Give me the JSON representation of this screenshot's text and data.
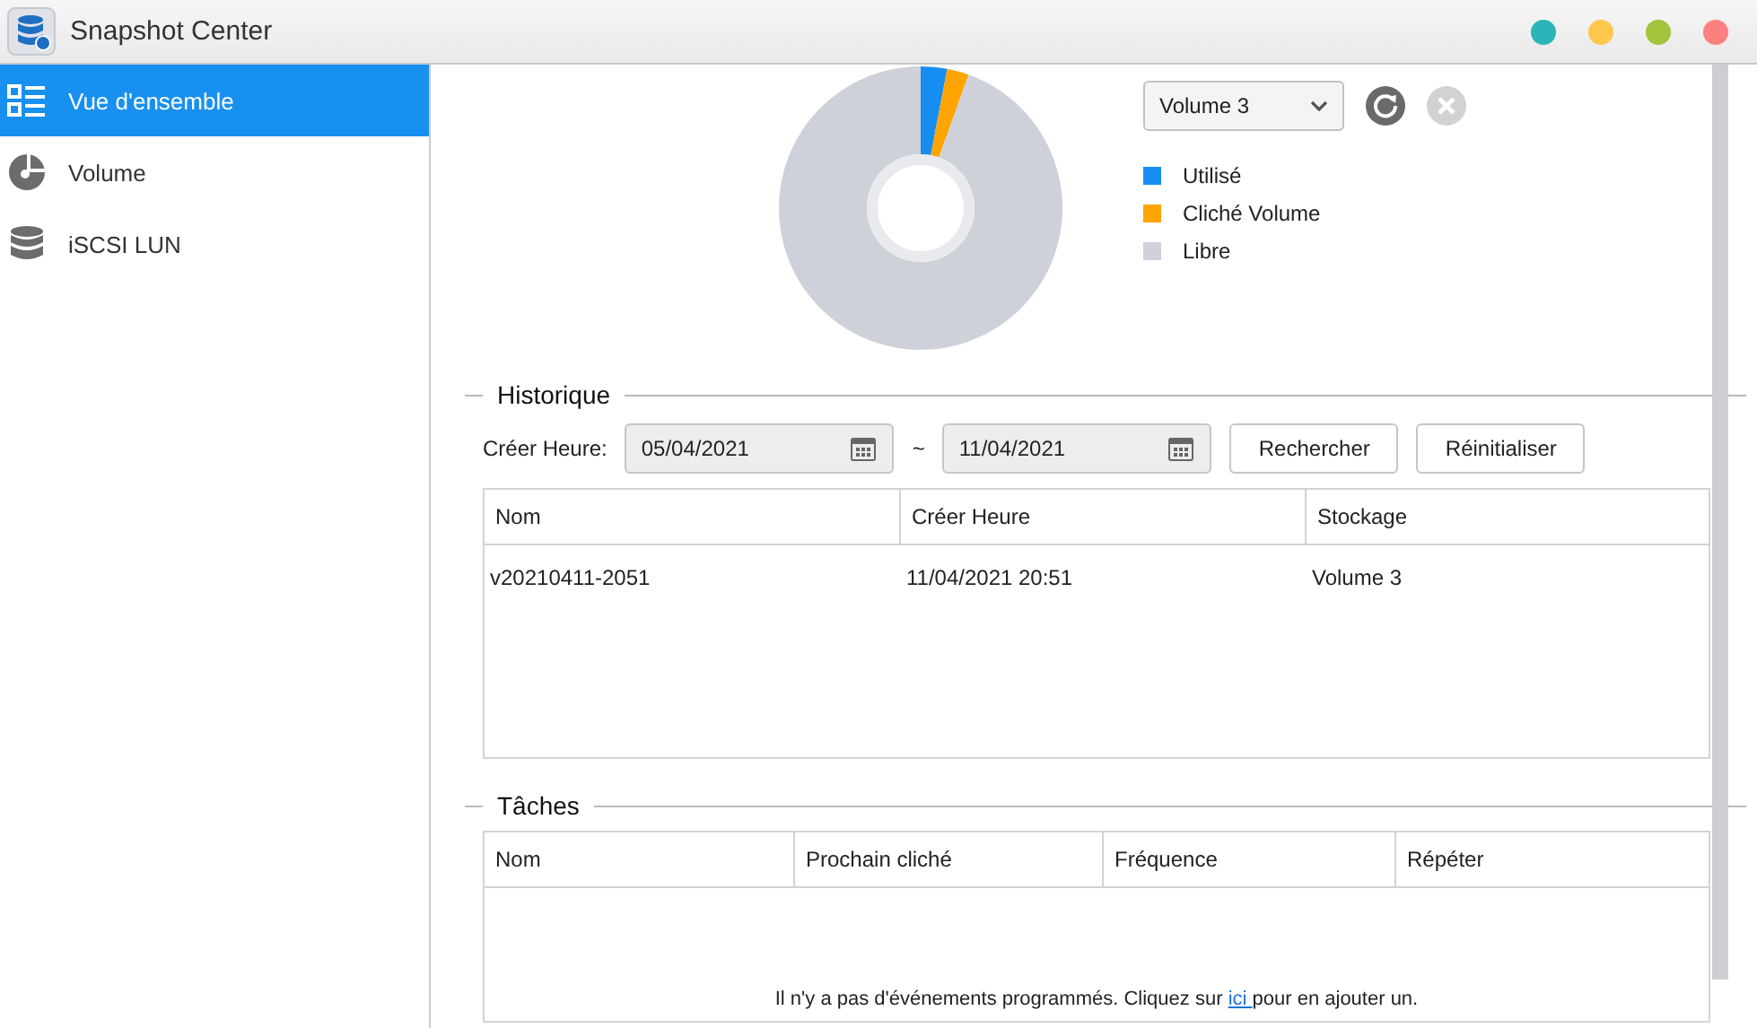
{
  "window": {
    "title": "Snapshot Center",
    "controls": [
      {
        "color": "#2bb5b8"
      },
      {
        "color": "#fdc84d"
      },
      {
        "color": "#a3c43c"
      },
      {
        "color": "#fb8080"
      }
    ]
  },
  "sidebar": {
    "items": [
      {
        "label": "Vue d'ensemble",
        "kind": "overview",
        "selected": true
      },
      {
        "label": "Volume",
        "kind": "volume",
        "selected": false
      },
      {
        "label": "iSCSI LUN",
        "kind": "lun",
        "selected": false
      }
    ]
  },
  "overview": {
    "volume_select": {
      "value": "Volume 3"
    },
    "legend": [
      {
        "label": "Utilisé",
        "color": "#168df0"
      },
      {
        "label": "Cliché Volume",
        "color": "#ffa400"
      },
      {
        "label": "Libre",
        "color": "#ced1d9"
      }
    ]
  },
  "history": {
    "title": "Historique",
    "filter_label": "Créer Heure:",
    "date_from": "05/04/2021",
    "separator": "~",
    "date_to": "11/04/2021",
    "buttons": [
      "Rechercher",
      "Réinitialiser"
    ],
    "columns": [
      "Nom",
      "Créer Heure",
      "Stockage"
    ],
    "rows": [
      [
        "v20210411-2051",
        "11/04/2021 20:51",
        "Volume 3"
      ]
    ]
  },
  "tasks": {
    "title": "Tâches",
    "columns": [
      "Nom",
      "Prochain cliché",
      "Fréquence",
      "Répéter"
    ],
    "empty_message": {
      "before": "Il n'y a pas d'événements programmés. Cliquez sur ",
      "link": "ici ",
      "after": "pour en ajouter un."
    }
  }
}
